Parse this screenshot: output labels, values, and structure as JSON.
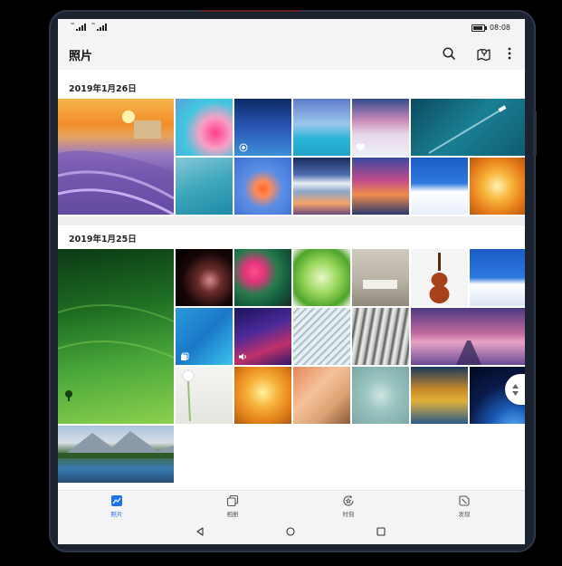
{
  "status_bar": {
    "signal_1_label": "⁴⁶",
    "signal_2_label": "⁴⁶",
    "time": "08:08",
    "battery_level": 0.9
  },
  "app_bar": {
    "title": "照片",
    "icons": [
      "search-icon",
      "map-icon",
      "more-vertical-icon"
    ]
  },
  "sections": [
    {
      "date": "2019年1月26日",
      "photos": [
        {
          "name": "lavender-sunset",
          "overlay": ""
        },
        {
          "name": "abstract-colors",
          "overlay": ""
        },
        {
          "name": "blue-night-sky",
          "overlay": "live-photo-icon"
        },
        {
          "name": "turquoise-sea",
          "overlay": ""
        },
        {
          "name": "snowy-pink-sunset",
          "overlay": "heart-icon"
        },
        {
          "name": "boat-ocean-aerial",
          "overlay": ""
        },
        {
          "name": "teal-wave",
          "overlay": ""
        },
        {
          "name": "color-splash",
          "overlay": ""
        },
        {
          "name": "mountain-lake",
          "overlay": ""
        },
        {
          "name": "purple-clouds",
          "overlay": ""
        },
        {
          "name": "santorini-blue",
          "overlay": ""
        },
        {
          "name": "yellow-flower",
          "overlay": ""
        }
      ]
    },
    {
      "date": "2019年1月25日",
      "photos": [
        {
          "name": "green-hills",
          "overlay": ""
        },
        {
          "name": "dark-abstract",
          "overlay": ""
        },
        {
          "name": "pink-flowers",
          "overlay": ""
        },
        {
          "name": "green-leaves",
          "overlay": ""
        },
        {
          "name": "living-room",
          "overlay": ""
        },
        {
          "name": "violin",
          "overlay": ""
        },
        {
          "name": "santorini-sea",
          "overlay": ""
        },
        {
          "name": "blue-gradient",
          "overlay": "album-icon"
        },
        {
          "name": "purple-wave",
          "overlay": "audio-icon"
        },
        {
          "name": "swirl-lines",
          "overlay": ""
        },
        {
          "name": "metal-curves",
          "overlay": ""
        },
        {
          "name": "pier-sunset",
          "overlay": ""
        },
        {
          "name": "white-flower",
          "overlay": ""
        },
        {
          "name": "orange-petals",
          "overlay": ""
        },
        {
          "name": "reading-window",
          "overlay": ""
        },
        {
          "name": "water-ripples",
          "overlay": ""
        },
        {
          "name": "autumn-lake",
          "overlay": ""
        },
        {
          "name": "earth-space",
          "overlay": ""
        },
        {
          "name": "alpine-lake",
          "overlay": ""
        }
      ]
    }
  ],
  "bottom_nav": {
    "items": [
      {
        "label": "照片",
        "icon": "photos-icon",
        "active": true
      },
      {
        "label": "相册",
        "icon": "albums-icon",
        "active": false
      },
      {
        "label": "时刻",
        "icon": "moments-icon",
        "active": false
      },
      {
        "label": "发现",
        "icon": "discover-icon",
        "active": false
      }
    ]
  },
  "colors": {
    "accent": "#1a73e8",
    "background": "#ffffff",
    "bars": "#f4f4f6"
  }
}
